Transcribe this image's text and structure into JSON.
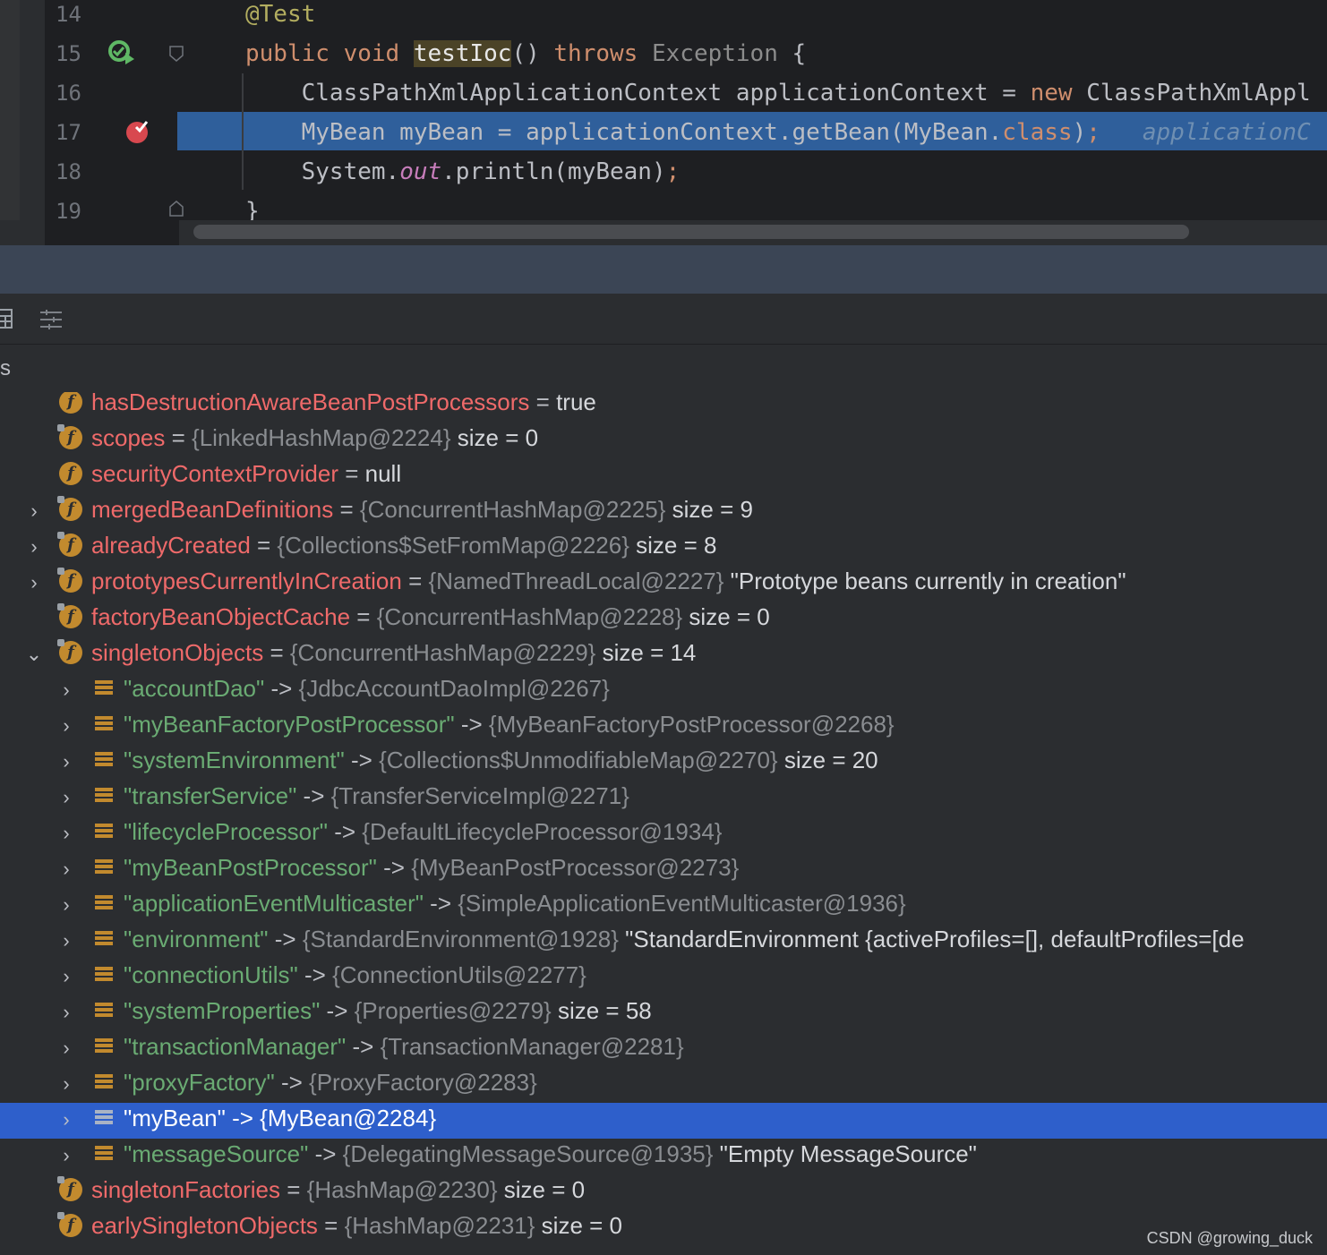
{
  "editor": {
    "lines": [
      {
        "num": "14",
        "tokens": [
          [
            "ann",
            "@Test"
          ]
        ]
      },
      {
        "num": "15",
        "tokens": [
          [
            "k",
            "public "
          ],
          [
            "k",
            "void "
          ],
          [
            "hl-fn",
            "testIoc"
          ],
          [
            "",
            "() "
          ],
          [
            "k",
            "throws "
          ],
          [
            "dim",
            "Exception"
          ],
          [
            "",
            " {"
          ]
        ]
      },
      {
        "num": "16",
        "tokens": [
          [
            "",
            "    ClassPathXmlApplicationContext applicationContext = "
          ],
          [
            "k",
            "new "
          ],
          [
            "",
            "ClassPathXmlAppl"
          ]
        ]
      },
      {
        "num": "17",
        "tokens": [
          [
            "",
            "    MyBean myBean = applicationContext.getBean(MyBean."
          ],
          [
            "cls",
            "class"
          ],
          [
            "",
            ")"
          ],
          [
            "k",
            ";"
          ],
          [
            "inlay",
            "   applicationC"
          ]
        ]
      },
      {
        "num": "18",
        "tokens": [
          [
            "",
            "    System."
          ],
          [
            "stat",
            "out"
          ],
          [
            "",
            ".println(myBean)"
          ],
          [
            "k",
            ";"
          ]
        ]
      },
      {
        "num": "19",
        "tokens": [
          [
            "",
            "}"
          ]
        ]
      }
    ]
  },
  "variables": {
    "header_label": "s",
    "rows": [
      {
        "indent": 0,
        "chevron": "",
        "icon": "f",
        "lock": false,
        "name": "hasDestructionAwareBeanPostProcessors",
        "ref": "",
        "value": "true"
      },
      {
        "indent": 0,
        "chevron": "",
        "icon": "f",
        "lock": true,
        "name": "scopes",
        "ref": "{LinkedHashMap@2224}",
        "value": "size = 0"
      },
      {
        "indent": 0,
        "chevron": "",
        "icon": "f",
        "lock": false,
        "name": "securityContextProvider",
        "ref": "",
        "value": "null"
      },
      {
        "indent": 0,
        "chevron": "›",
        "icon": "f",
        "lock": true,
        "name": "mergedBeanDefinitions",
        "ref": "{ConcurrentHashMap@2225}",
        "value": "size = 9"
      },
      {
        "indent": 0,
        "chevron": "›",
        "icon": "f",
        "lock": true,
        "name": "alreadyCreated",
        "ref": "{Collections$SetFromMap@2226}",
        "value": "size = 8"
      },
      {
        "indent": 0,
        "chevron": "›",
        "icon": "f",
        "lock": true,
        "name": "prototypesCurrentlyInCreation",
        "ref": "{NamedThreadLocal@2227}",
        "value": "\"Prototype beans currently in creation\""
      },
      {
        "indent": 0,
        "chevron": "",
        "icon": "f",
        "lock": true,
        "name": "factoryBeanObjectCache",
        "ref": "{ConcurrentHashMap@2228}",
        "value": "size = 0"
      },
      {
        "indent": 0,
        "chevron": "⌄",
        "icon": "f",
        "lock": true,
        "name": "singletonObjects",
        "ref": "{ConcurrentHashMap@2229}",
        "value": "size = 14"
      },
      {
        "indent": 1,
        "chevron": "›",
        "icon": "e",
        "key": "\"accountDao\"",
        "ref": "{JdbcAccountDaoImpl@2267}",
        "value": ""
      },
      {
        "indent": 1,
        "chevron": "›",
        "icon": "e",
        "key": "\"myBeanFactoryPostProcessor\"",
        "ref": "{MyBeanFactoryPostProcessor@2268}",
        "value": ""
      },
      {
        "indent": 1,
        "chevron": "›",
        "icon": "e",
        "key": "\"systemEnvironment\"",
        "ref": "{Collections$UnmodifiableMap@2270}",
        "value": "size = 20"
      },
      {
        "indent": 1,
        "chevron": "›",
        "icon": "e",
        "key": "\"transferService\"",
        "ref": "{TransferServiceImpl@2271}",
        "value": ""
      },
      {
        "indent": 1,
        "chevron": "›",
        "icon": "e",
        "key": "\"lifecycleProcessor\"",
        "ref": "{DefaultLifecycleProcessor@1934}",
        "value": ""
      },
      {
        "indent": 1,
        "chevron": "›",
        "icon": "e",
        "key": "\"myBeanPostProcessor\"",
        "ref": "{MyBeanPostProcessor@2273}",
        "value": ""
      },
      {
        "indent": 1,
        "chevron": "›",
        "icon": "e",
        "key": "\"applicationEventMulticaster\"",
        "ref": "{SimpleApplicationEventMulticaster@1936}",
        "value": ""
      },
      {
        "indent": 1,
        "chevron": "›",
        "icon": "e",
        "key": "\"environment\"",
        "ref": "{StandardEnvironment@1928}",
        "value": "\"StandardEnvironment {activeProfiles=[], defaultProfiles=[de"
      },
      {
        "indent": 1,
        "chevron": "›",
        "icon": "e",
        "key": "\"connectionUtils\"",
        "ref": "{ConnectionUtils@2277}",
        "value": ""
      },
      {
        "indent": 1,
        "chevron": "›",
        "icon": "e",
        "key": "\"systemProperties\"",
        "ref": "{Properties@2279}",
        "value": "size = 58"
      },
      {
        "indent": 1,
        "chevron": "›",
        "icon": "e",
        "key": "\"transactionManager\"",
        "ref": "{TransactionManager@2281}",
        "value": ""
      },
      {
        "indent": 1,
        "chevron": "›",
        "icon": "e",
        "key": "\"proxyFactory\"",
        "ref": "{ProxyFactory@2283}",
        "value": ""
      },
      {
        "indent": 1,
        "chevron": "›",
        "icon": "e",
        "key": "\"myBean\"",
        "ref": "{MyBean@2284}",
        "value": "",
        "selected": true
      },
      {
        "indent": 1,
        "chevron": "›",
        "icon": "e",
        "key": "\"messageSource\"",
        "ref": "{DelegatingMessageSource@1935}",
        "value": "\"Empty MessageSource\""
      },
      {
        "indent": 0,
        "chevron": "",
        "icon": "f",
        "lock": true,
        "name": "singletonFactories",
        "ref": "{HashMap@2230}",
        "value": "size = 0"
      },
      {
        "indent": 0,
        "chevron": "",
        "icon": "f",
        "lock": true,
        "name": "earlySingletonObjects",
        "ref": "{HashMap@2231}",
        "value": "size = 0"
      }
    ]
  },
  "watermark": "CSDN @growing_duck",
  "colors": {
    "current_line": "#2f5f9b",
    "selected_row": "#2e5fcb",
    "field_name": "#ef6a6a",
    "map_key": "#6aab73",
    "field_icon": "#c28a2e"
  }
}
